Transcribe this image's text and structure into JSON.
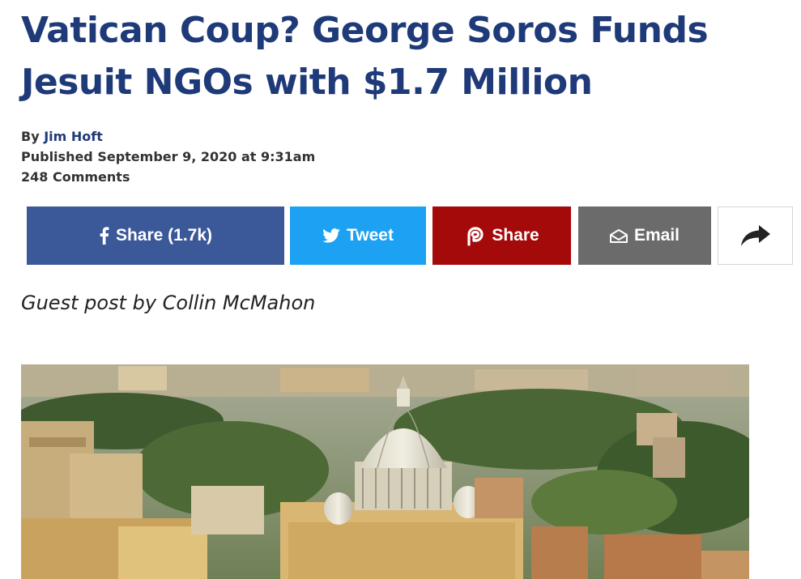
{
  "article": {
    "title": "Vatican Coup? George Soros Funds Jesuit NGOs with $1.7 Million",
    "by_prefix": "By ",
    "author": "Jim Hoft",
    "published": "Published September 9, 2020 at 9:31am",
    "comments": "248 Comments",
    "guest_post": "Guest post by Collin McMahon"
  },
  "share": {
    "facebook_label": "Share (1.7k)",
    "twitter_label": "Tweet",
    "parler_label": "Share",
    "email_label": "Email"
  },
  "icons": {
    "facebook": "facebook-icon",
    "twitter": "twitter-icon",
    "parler": "parler-icon",
    "email": "email-icon",
    "more": "share-arrow-icon"
  },
  "colors": {
    "title": "#1f3a78",
    "facebook": "#3b5998",
    "twitter": "#1da1f2",
    "parler": "#a50a0a",
    "email": "#6b6b6b"
  }
}
